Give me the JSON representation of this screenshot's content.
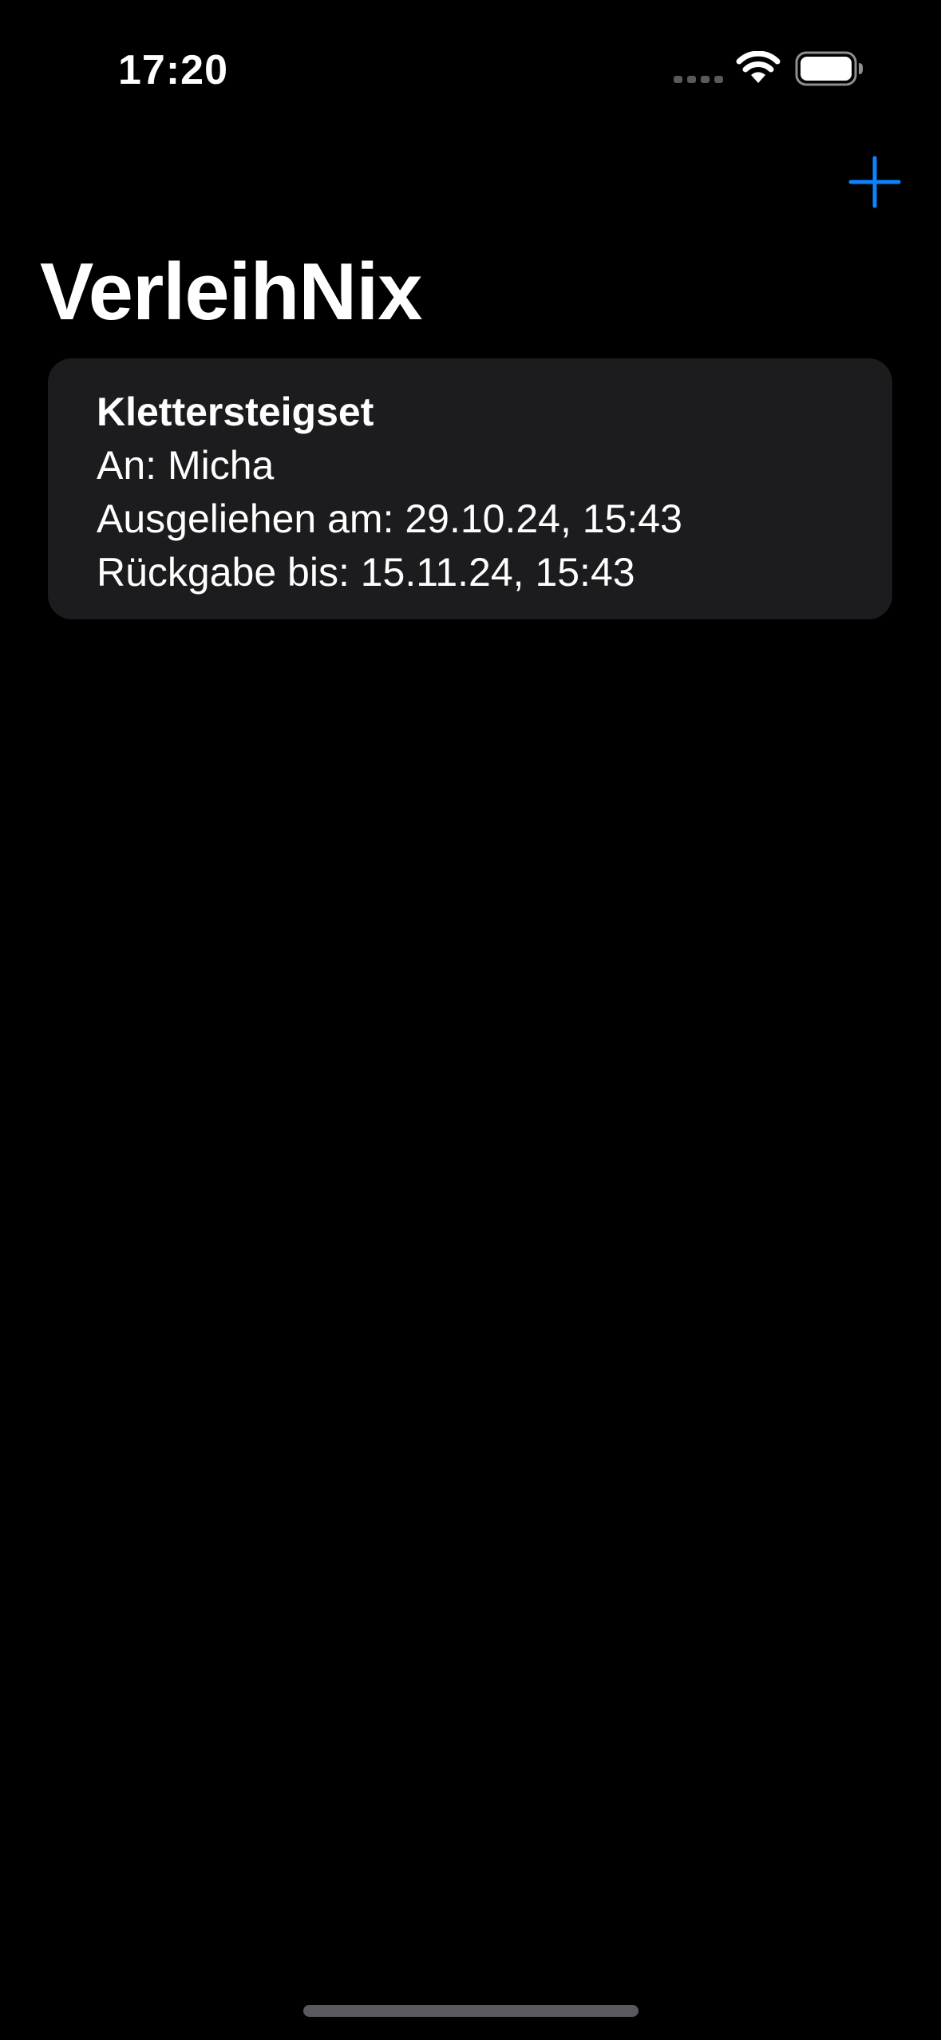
{
  "status_bar": {
    "time": "17:20",
    "icons": [
      "cellular-signal-icon",
      "wifi-icon",
      "battery-icon"
    ]
  },
  "nav": {
    "title": "VerleihNix",
    "add_icon": "plus-icon",
    "accent_color": "#0a84ff"
  },
  "loans": [
    {
      "item": "Klettersteigset",
      "to": "An: Micha",
      "lent_on": "Ausgeliehen am: 29.10.24, 15:43",
      "return_by": "Rückgabe bis: 15.11.24, 15:43"
    }
  ],
  "colors": {
    "background": "#000000",
    "card": "#1c1c1e",
    "text": "#ffffff"
  }
}
